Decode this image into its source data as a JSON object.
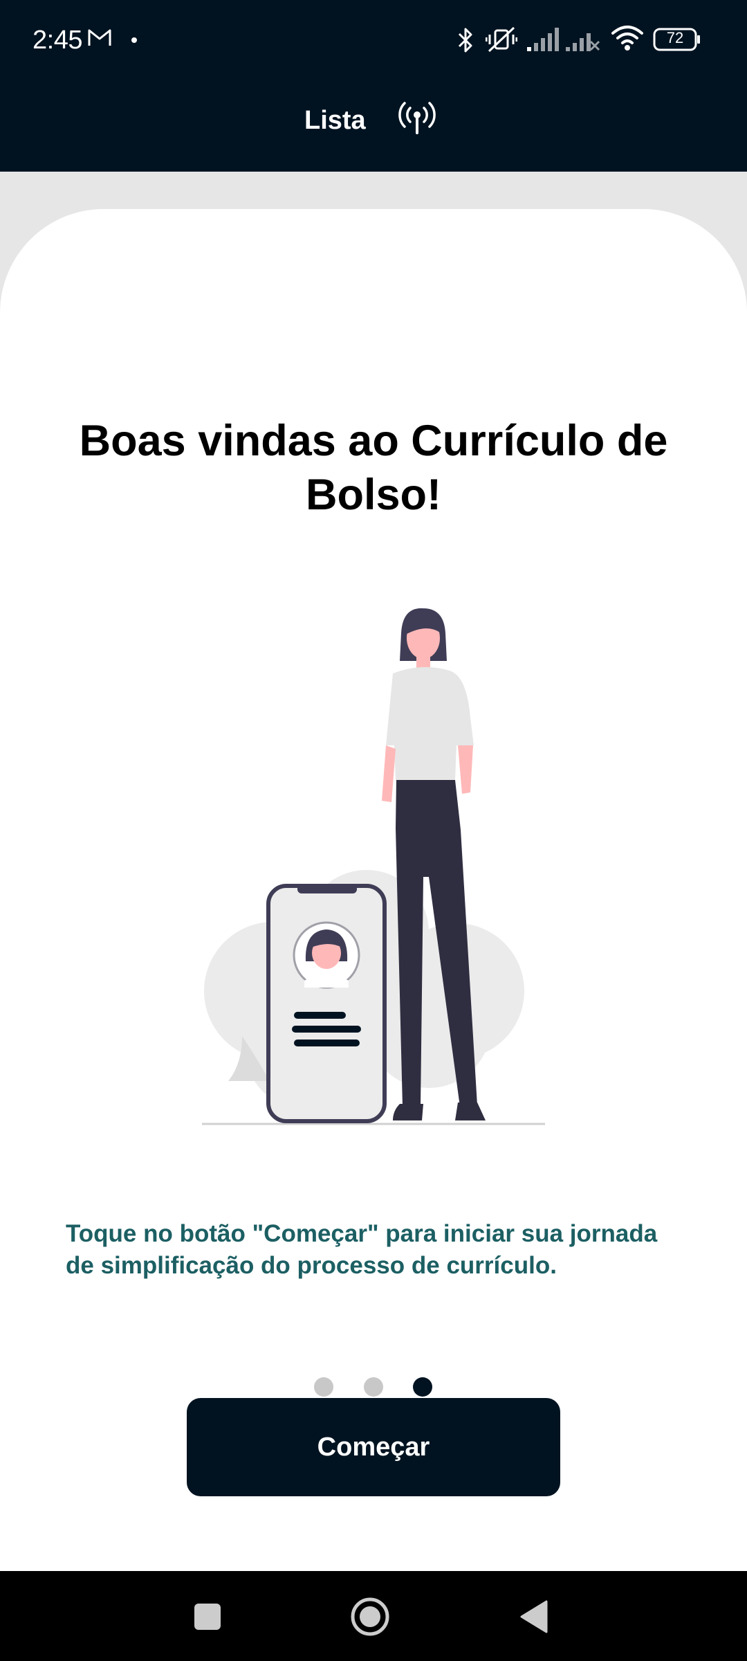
{
  "status_bar": {
    "time": "2:45",
    "battery": "72",
    "icons": [
      "gmail-icon",
      "bluetooth-icon",
      "vibrate-off-icon",
      "signal-icon",
      "signal-no-service-icon",
      "wifi-icon",
      "battery-icon"
    ]
  },
  "header": {
    "title": "Lista",
    "icon": "broadcast-icon"
  },
  "onboarding": {
    "title": "Boas vindas ao Currículo de Bolso!",
    "illustration": "woman-with-phone-profile-illustration",
    "instruction": "Toque no botão \"Começar\" para iniciar sua jornada de simplificação do processo de currículo.",
    "pager": {
      "total_pages": 3,
      "current_page": 3
    },
    "start_button_label": "Começar"
  },
  "nav_bar": {
    "buttons": [
      "recents-button",
      "home-button",
      "back-button"
    ]
  },
  "colors": {
    "header_bg": "#011321",
    "accent_text": "#1c5f63",
    "page_bg": "#e6e6e6",
    "card_bg": "#ffffff",
    "dot_inactive": "#c8c8c8"
  }
}
